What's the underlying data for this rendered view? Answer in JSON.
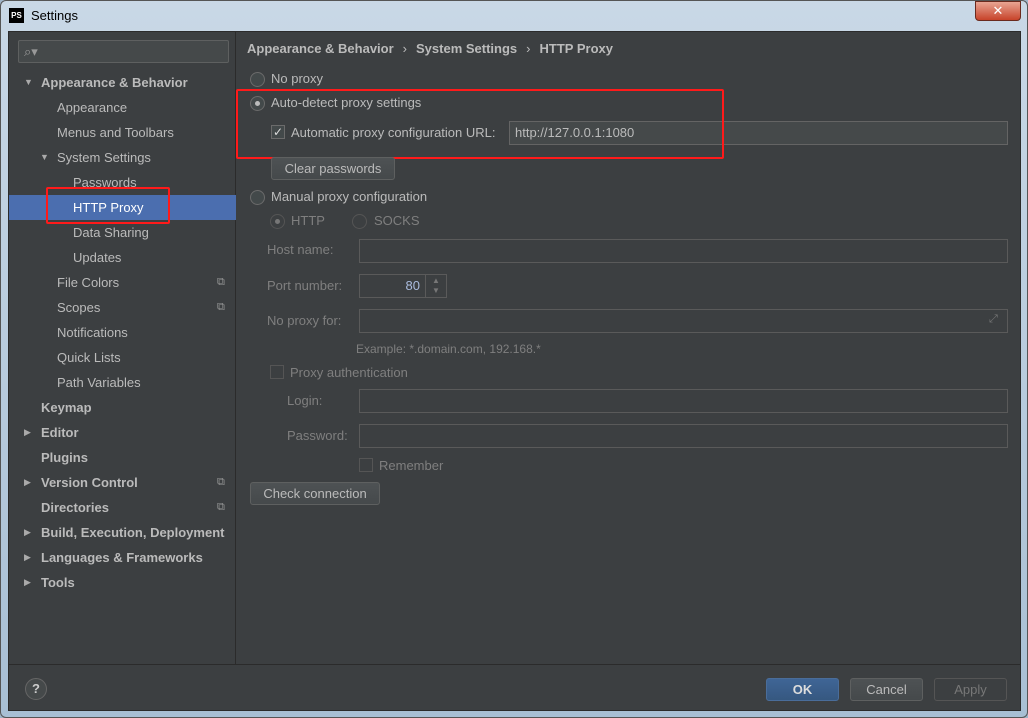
{
  "window": {
    "title": "Settings",
    "app_icon": "PS",
    "close_label": "✕"
  },
  "search": {
    "placeholder": ""
  },
  "sidebar": {
    "items": [
      {
        "label": "Appearance & Behavior",
        "level": 0,
        "bold": true,
        "arrow": "down"
      },
      {
        "label": "Appearance",
        "level": 1
      },
      {
        "label": "Menus and Toolbars",
        "level": 1
      },
      {
        "label": "System Settings",
        "level": 1,
        "arrow": "down"
      },
      {
        "label": "Passwords",
        "level": 2
      },
      {
        "label": "HTTP Proxy",
        "level": 2,
        "selected": true
      },
      {
        "label": "Data Sharing",
        "level": 2
      },
      {
        "label": "Updates",
        "level": 2
      },
      {
        "label": "File Colors",
        "level": 1,
        "badge": true
      },
      {
        "label": "Scopes",
        "level": 1,
        "badge": true
      },
      {
        "label": "Notifications",
        "level": 1
      },
      {
        "label": "Quick Lists",
        "level": 1
      },
      {
        "label": "Path Variables",
        "level": 1
      },
      {
        "label": "Keymap",
        "level": 0,
        "bold": true
      },
      {
        "label": "Editor",
        "level": 0,
        "bold": true,
        "arrow": "right"
      },
      {
        "label": "Plugins",
        "level": 0,
        "bold": true
      },
      {
        "label": "Version Control",
        "level": 0,
        "bold": true,
        "arrow": "right",
        "badge": true
      },
      {
        "label": "Directories",
        "level": 0,
        "bold": true,
        "badge": true
      },
      {
        "label": "Build, Execution, Deployment",
        "level": 0,
        "bold": true,
        "arrow": "right"
      },
      {
        "label": "Languages & Frameworks",
        "level": 0,
        "bold": true,
        "arrow": "right"
      },
      {
        "label": "Tools",
        "level": 0,
        "bold": true,
        "arrow": "right"
      }
    ]
  },
  "breadcrumb": [
    "Appearance & Behavior",
    "System Settings",
    "HTTP Proxy"
  ],
  "proxy": {
    "no_proxy": "No proxy",
    "auto_detect": "Auto-detect proxy settings",
    "auto_url_label": "Automatic proxy configuration URL:",
    "auto_url_value": "http://127.0.0.1:1080",
    "auto_url_checked": true,
    "clear_passwords": "Clear passwords",
    "manual": "Manual proxy configuration",
    "http": "HTTP",
    "socks": "SOCKS",
    "host_label": "Host name:",
    "host_value": "",
    "port_label": "Port number:",
    "port_value": "80",
    "no_proxy_for_label": "No proxy for:",
    "no_proxy_for_value": "",
    "example": "Example: *.domain.com, 192.168.*",
    "proxy_auth": "Proxy authentication",
    "login_label": "Login:",
    "password_label": "Password:",
    "remember": "Remember",
    "check_connection": "Check connection",
    "selected_mode": "auto_detect"
  },
  "footer": {
    "help": "?",
    "ok": "OK",
    "cancel": "Cancel",
    "apply": "Apply"
  },
  "colors": {
    "background": "#3c3f41",
    "selection": "#4b6eaf",
    "highlight": "#ff1a1a",
    "ok_button": "#365880"
  }
}
